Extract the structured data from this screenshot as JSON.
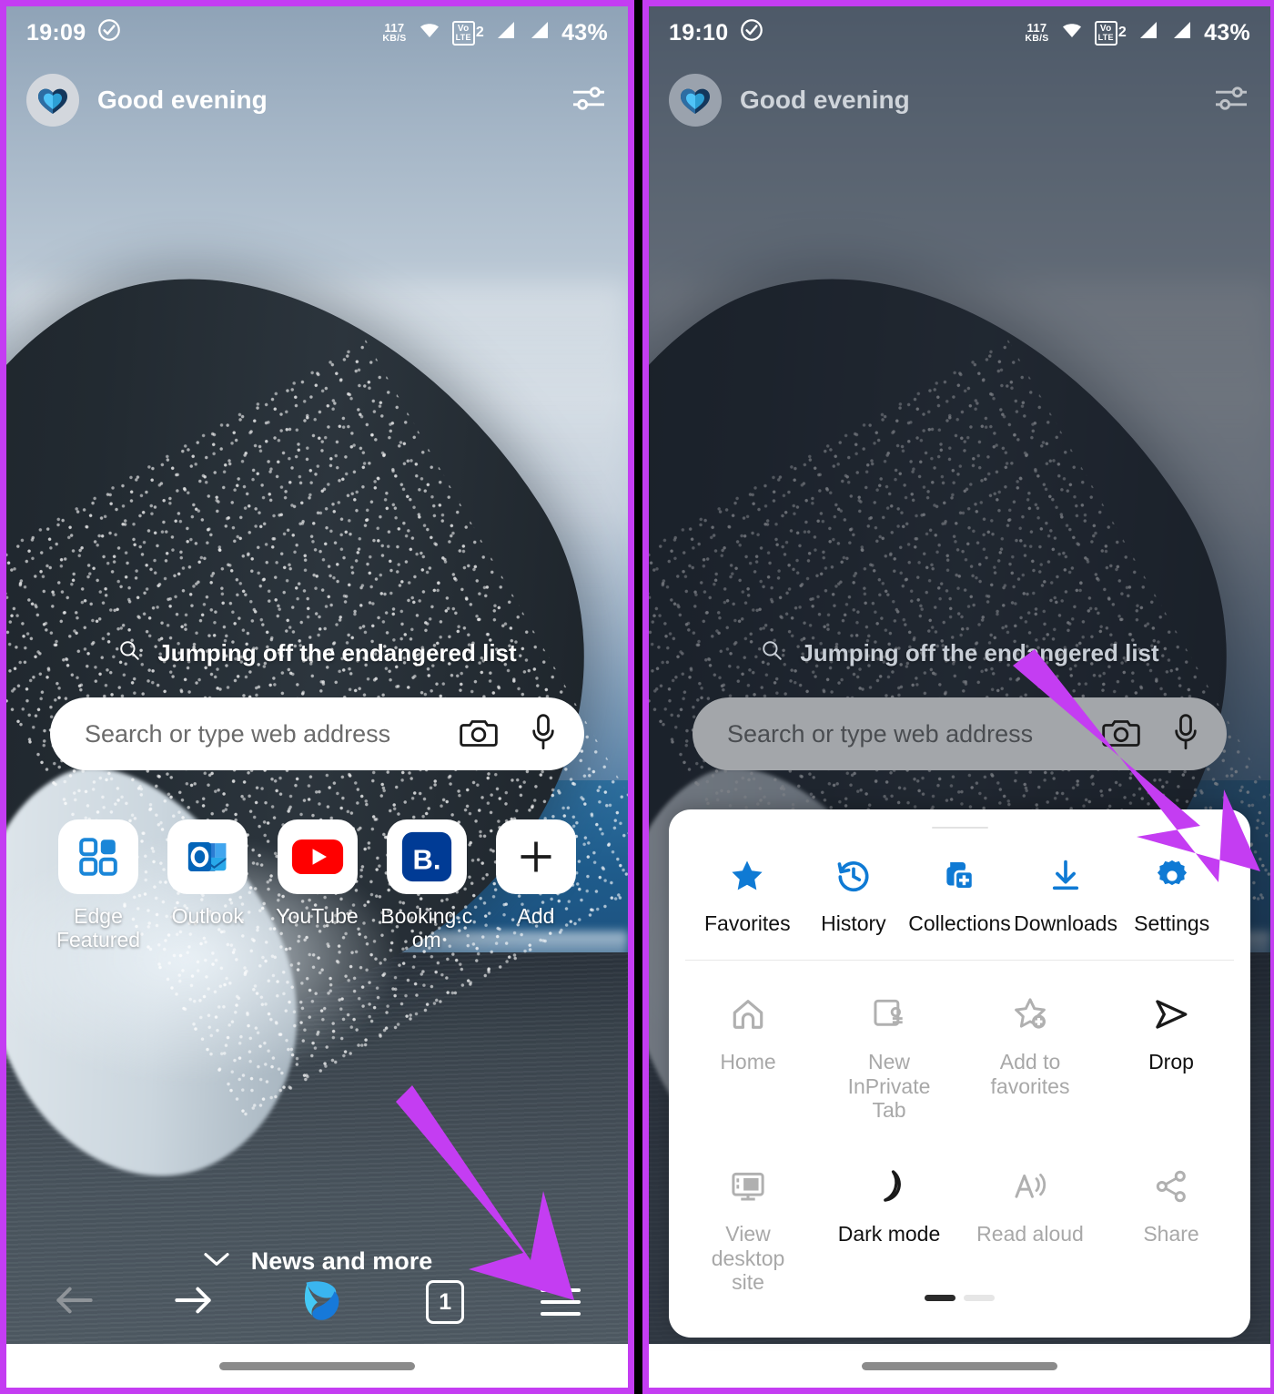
{
  "theme": {
    "annotation_arrow_color": "#c43df2",
    "panel_border_color": "#c43df2",
    "accent_blue": "#0f7ad4",
    "disabled_grey": "#a8a8a8"
  },
  "panels": [
    {
      "id": "left",
      "status_bar": {
        "time": "19:09",
        "check_icon": "check-circle-icon",
        "net_speed_value": "117",
        "net_speed_unit": "KB/S",
        "wifi_icon": "wifi-icon",
        "volte_label": "Vo",
        "volte_sub": "LTE",
        "volte_num": "2",
        "signal_1": "signal-bars-icon",
        "signal_2": "signal-bars-icon",
        "battery": "43%"
      },
      "header": {
        "logo_icon": "edge-heart-logo",
        "greeting": "Good evening",
        "tune_icon": "tune-sliders-icon"
      },
      "suggestion": {
        "icon": "search-icon",
        "text": "Jumping off the endangered list"
      },
      "search": {
        "placeholder": "Search or type web address",
        "camera_icon": "camera-icon",
        "mic_icon": "microphone-icon"
      },
      "shortcuts": [
        {
          "label": "Edge Featured",
          "icon": "edge-featured-grid-icon"
        },
        {
          "label": "Outlook",
          "icon": "outlook-icon"
        },
        {
          "label": "YouTube",
          "icon": "youtube-icon"
        },
        {
          "label": "Booking.com",
          "icon": "booking-com-icon"
        },
        {
          "label": "Add",
          "icon": "plus-icon"
        }
      ],
      "feed": {
        "chevron_icon": "chevron-down-icon",
        "label": "News and more"
      },
      "bottom_nav": [
        {
          "name": "back",
          "icon": "arrow-left-icon",
          "state": "disabled"
        },
        {
          "name": "forward",
          "icon": "arrow-right-icon",
          "state": "enabled"
        },
        {
          "name": "copilot",
          "icon": "copilot-icon",
          "state": "enabled"
        },
        {
          "name": "tabs",
          "icon": "tab-count-icon",
          "value": "1",
          "state": "enabled"
        },
        {
          "name": "menu",
          "icon": "hamburger-menu-icon",
          "state": "enabled"
        }
      ],
      "annotation": {
        "arrow": "points to hamburger menu button"
      }
    },
    {
      "id": "right",
      "status_bar": {
        "time": "19:10",
        "check_icon": "check-circle-icon",
        "net_speed_value": "117",
        "net_speed_unit": "KB/S",
        "wifi_icon": "wifi-icon",
        "volte_label": "Vo",
        "volte_sub": "LTE",
        "volte_num": "2",
        "signal_1": "signal-bars-icon",
        "signal_2": "signal-bars-icon",
        "battery": "43%"
      },
      "header": {
        "logo_icon": "edge-heart-logo",
        "greeting": "Good evening",
        "tune_icon": "tune-sliders-icon"
      },
      "suggestion": {
        "icon": "search-icon",
        "text": "Jumping off the endangered list"
      },
      "search": {
        "placeholder": "Search or type web address",
        "camera_icon": "camera-icon",
        "mic_icon": "microphone-icon"
      },
      "sheet": {
        "handle": "drag-handle",
        "row1": [
          {
            "label": "Favorites",
            "icon": "star-filled-icon",
            "state": "enabled"
          },
          {
            "label": "History",
            "icon": "history-clock-icon",
            "state": "enabled"
          },
          {
            "label": "Collections",
            "icon": "collections-icon",
            "state": "enabled"
          },
          {
            "label": "Downloads",
            "icon": "download-icon",
            "state": "enabled"
          },
          {
            "label": "Settings",
            "icon": "gear-icon",
            "state": "enabled"
          }
        ],
        "row2": [
          {
            "label": "Home",
            "icon": "home-icon",
            "state": "disabled"
          },
          {
            "label": "New InPrivate Tab",
            "icon": "inprivate-tab-icon",
            "state": "disabled"
          },
          {
            "label": "Add to favorites",
            "icon": "star-plus-icon",
            "state": "disabled"
          },
          {
            "label": "Drop",
            "icon": "drop-send-icon",
            "state": "enabled"
          }
        ],
        "row3": [
          {
            "label": "View desktop site",
            "icon": "desktop-monitor-icon",
            "state": "disabled"
          },
          {
            "label": "Dark mode",
            "icon": "moon-icon",
            "state": "enabled"
          },
          {
            "label": "Read aloud",
            "icon": "read-aloud-icon",
            "state": "disabled"
          },
          {
            "label": "Share",
            "icon": "share-icon",
            "state": "disabled"
          }
        ],
        "pager": {
          "pages": 2,
          "active": 1
        }
      },
      "annotation": {
        "arrow": "points to Settings gear"
      }
    }
  ]
}
